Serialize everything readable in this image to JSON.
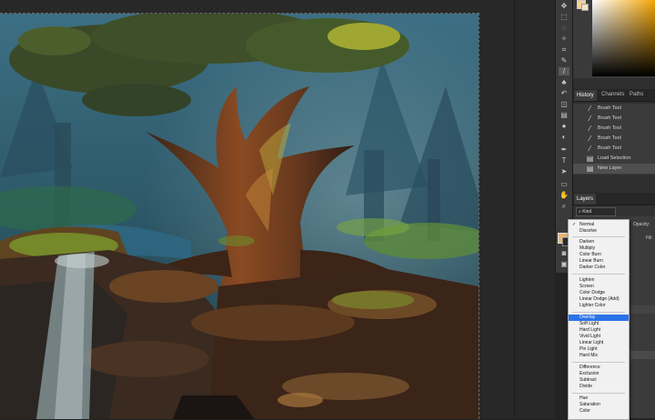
{
  "panels": {
    "tabs": [
      "History",
      "Channels",
      "Paths"
    ],
    "history_items": [
      {
        "label": "Brush Tool",
        "icon": "brush-icon"
      },
      {
        "label": "Brush Tool",
        "icon": "brush-icon"
      },
      {
        "label": "Brush Tool",
        "icon": "brush-icon"
      },
      {
        "label": "Brush Tool",
        "icon": "brush-icon"
      },
      {
        "label": "Brush Tool",
        "icon": "brush-icon"
      },
      {
        "label": "Load Selection",
        "icon": "document-icon"
      },
      {
        "label": "New Layer",
        "icon": "document-icon"
      }
    ],
    "layers_tab": "Layers",
    "kind_label": "Kind",
    "opacity_label": "Opacity:",
    "fill_label": "Fill:"
  },
  "colors": {
    "foreground": "#e8b774",
    "menu_highlight": "#2b73e8"
  },
  "blend_modes": {
    "current": "Normal",
    "highlighted": "Overlay",
    "groups": [
      [
        "Normal",
        "Dissolve"
      ],
      [
        "Darken",
        "Multiply",
        "Color Burn",
        "Linear Burn",
        "Darker Color"
      ],
      [
        "Lighten",
        "Screen",
        "Color Dodge",
        "Linear Dodge (Add)",
        "Lighter Color"
      ],
      [
        "Overlay",
        "Soft Light",
        "Hard Light",
        "Vivid Light",
        "Linear Light",
        "Pin Light",
        "Hard Mix"
      ],
      [
        "Difference",
        "Exclusion",
        "Subtract",
        "Divide"
      ],
      [
        "Hue",
        "Saturation",
        "Color"
      ]
    ]
  }
}
